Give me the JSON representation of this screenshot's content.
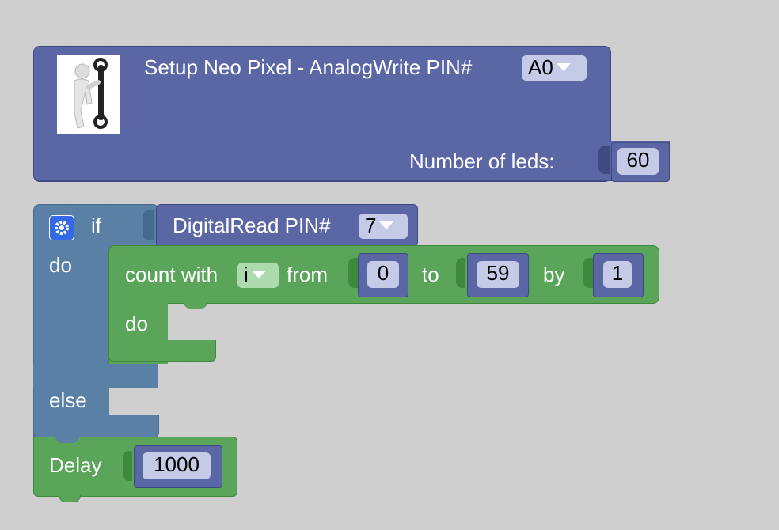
{
  "colors": {
    "purple_block": "#5b67a5",
    "blue_block": "#5b80a5",
    "green_block": "#5ba55b",
    "field_bg": "#c5cae6",
    "green_field_bg": "#aedbae",
    "background": "#ffffff",
    "grid_dot": "#cccccc"
  },
  "setup_block": {
    "icon": "mechanic-figure-icon",
    "label": "Setup Neo Pixel - AnalogWrite PIN#",
    "pin_value": "A0",
    "leds_label": "Number of leds:",
    "leds_value": "60"
  },
  "if_block": {
    "gear_icon": "gear-icon",
    "if_label": "if",
    "do_label": "do",
    "else_label": "else",
    "condition": {
      "label": "DigitalRead PIN#",
      "pin_value": "7"
    }
  },
  "count_block": {
    "label": "count with",
    "var_value": "i",
    "from_label": "from",
    "from_value": "0",
    "to_label": "to",
    "to_value": "59",
    "by_label": "by",
    "by_value": "1",
    "do_label": "do"
  },
  "delay_block": {
    "label": "Delay",
    "value": "1000"
  }
}
